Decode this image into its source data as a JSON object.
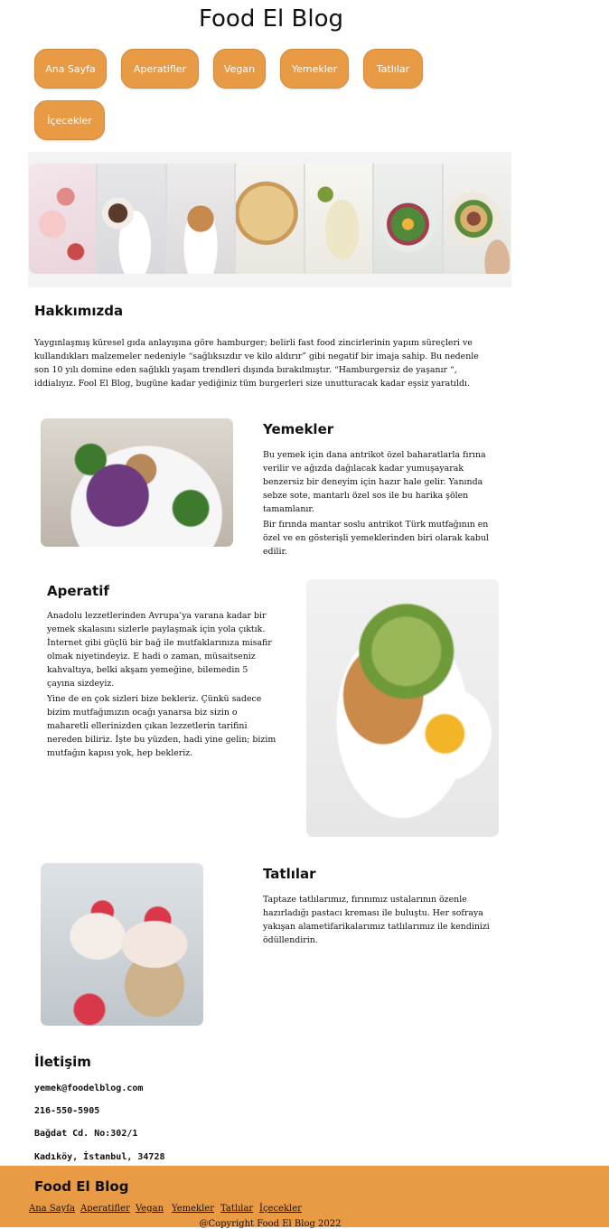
{
  "site": {
    "title": "Food El Blog"
  },
  "nav": [
    {
      "label": "Ana Sayfa"
    },
    {
      "label": "Aperatifler"
    },
    {
      "label": "Vegan"
    },
    {
      "label": "Yemekler"
    },
    {
      "label": "Tatlılar"
    },
    {
      "label": "İçecekler"
    }
  ],
  "about": {
    "heading": "Hakkımızda",
    "text": "Yaygınlaşmış küresel gıda anlayışına göre hamburger; belirli fast food zincirlerinin yapım süreçleri ve kullandıkları malzemeler nedeniyle “sağlıksızdır ve kilo aldırır” gibi negatif bir imaja sahip. Bu nedenle son 10 yılı domine eden sağlıklı yaşam trendleri dışında bırakılmıştır. “Hamburgersiz de yaşanır “, iddialıyız. Fool El Blog, bugüne kadar yediğiniz tüm burgerleri size unutturacak kadar eşsiz yaratıldı."
  },
  "yemekler": {
    "heading": "Yemekler",
    "p1": "Bu yemek için dana antrikot özel baharatlarla fırına verilir ve ağızda dağılacak kadar yumuşayarak benzersiz bir deneyim için hazır hale gelir. Yanında sebze sote, mantarlı özel sos ile bu harika şölen tamamlanır.",
    "p2": "Bir fırında mantar soslu antrikot Türk mutfağının en özel ve en gösterişli yemeklerinden biri olarak kabul edilir."
  },
  "aperatif": {
    "heading": "Aperatif",
    "p1": "Anadolu lezzetlerinden Avrupa’ya varana kadar bir yemek skalasını sizlerle paylaşmak için yola çıktık. İnternet gibi güçlü bir bağ ile mutfaklarınıza misafir olmak niyetindeyiz. E hadi o zaman, müsaitseniz kahvaltıya, belki akşam yemeğine, bilemedin 5 çayına sizdeyiz.",
    "p2": "Yine de en çok sizleri bize bekleriz. Çünkü sadece bizim mutfağımızın ocağı yanarsa biz sizin o maharetli ellerinizden çıkan lezzetlerin tarifini nereden biliriz. İşte bu yüzden, hadi yine gelin; bizim mutfağın kapısı yok, hep bekleriz."
  },
  "tatlilar": {
    "heading": "Tatlılar",
    "text": "Taptaze tatlılarımız, fırınımız ustalarının özenle hazırladığı pastacı kreması ile buluştu. Her sofraya yakışan alametifarikalarımız tatlılarımız ile kendinizi ödüllendirin."
  },
  "contact": {
    "heading": "İletişim",
    "email": "yemek@foodelblog.com",
    "phone": "216-550-5905",
    "address1": "Bağdat Cd. No:302/1",
    "address2": "Kadıköy, İstanbul, 34728"
  },
  "footer": {
    "title": "Food El Blog",
    "links": [
      {
        "label": "Ana Sayfa"
      },
      {
        "label": "Aperatifler"
      },
      {
        "label": "Vegan"
      },
      {
        "label": "Yemekler"
      },
      {
        "label": "Tatlılar"
      },
      {
        "label": "İçecekler"
      }
    ],
    "copyright": "@Copyright Food El Blog 2022"
  },
  "colors": {
    "accent": "#e99a45"
  }
}
